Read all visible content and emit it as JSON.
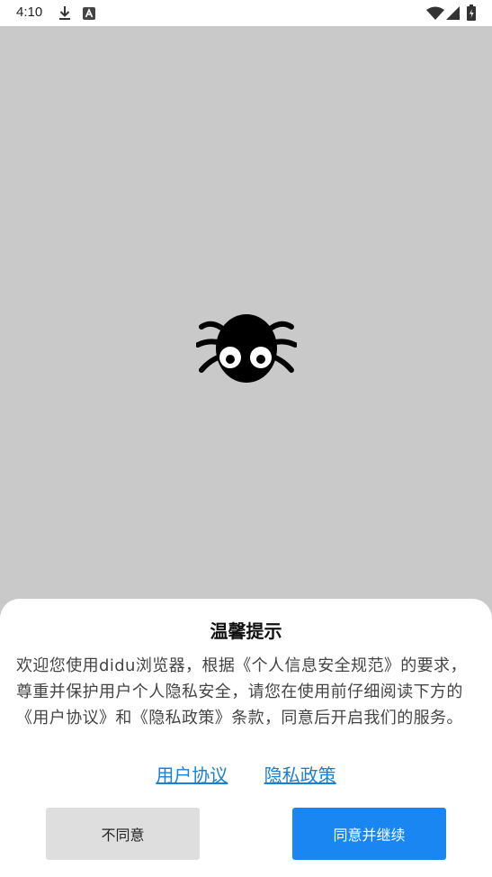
{
  "status_bar": {
    "time": "4:10",
    "left_icons": [
      "download-icon",
      "app-a-icon"
    ],
    "right_icons": [
      "wifi-icon",
      "signal-icon",
      "battery-icon"
    ]
  },
  "app": {
    "background_color": "#c9c9c9",
    "mascot_icon": "spider-icon"
  },
  "dialog": {
    "title": "温馨提示",
    "body": "欢迎您使用didu浏览器，根据《个人信息安全规范》的要求，尊重并保护用户个人隐私安全，请您在使用前仔细阅读下方的《用户协议》和《隐私政策》条款，同意后开启我们的服务。",
    "links": {
      "user_agreement": "用户协议",
      "privacy_policy": "隐私政策"
    },
    "buttons": {
      "disagree": "不同意",
      "agree": "同意并继续"
    },
    "accent_color": "#1a86f2",
    "link_color": "#1a7fd6"
  }
}
